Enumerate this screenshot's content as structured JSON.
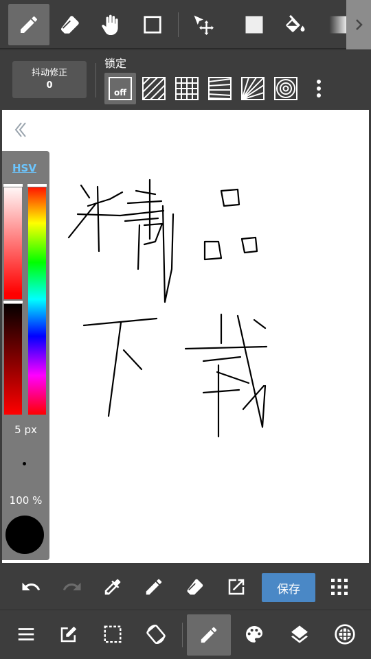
{
  "stabilizer": {
    "label": "抖动修正",
    "value": "0"
  },
  "lock": {
    "label": "锁定",
    "off_label": "off"
  },
  "color_panel": {
    "mode_label": "HSV",
    "brush_size": "5 px",
    "opacity": "100 %"
  },
  "actions": {
    "save_label": "保存"
  },
  "colors": {
    "toolbar_bg": "#3d3d3d",
    "selected_tool": "#6a6a6a",
    "save_button": "#4a88c6",
    "hsv_link": "#6cc6ff",
    "brush_color": "#000000"
  }
}
